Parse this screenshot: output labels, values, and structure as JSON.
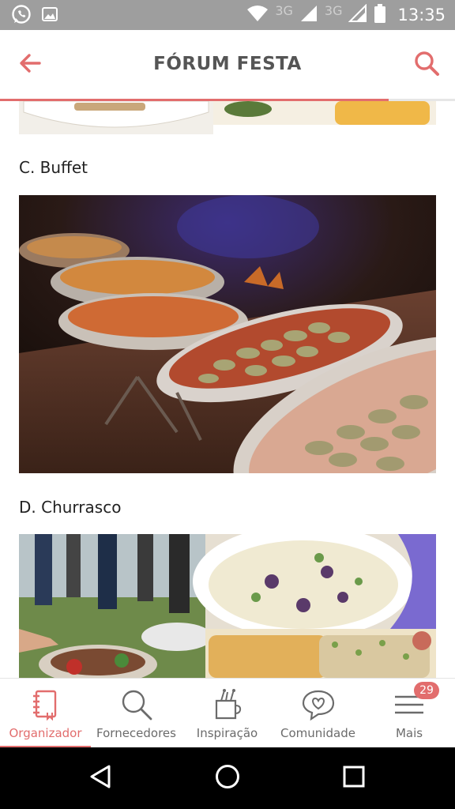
{
  "status_bar": {
    "network_1": "3G",
    "network_2": "3G",
    "time": "13:35",
    "icons": [
      "whatsapp-icon",
      "image-icon",
      "wifi-icon",
      "signal-icon",
      "signal-icon",
      "battery-icon"
    ]
  },
  "header": {
    "title": "FÓRUM FESTA",
    "back_icon": "arrow-left-icon",
    "search_icon": "search-icon",
    "reading_progress": 0.855
  },
  "content": {
    "sections": [
      {
        "label": "C. Buffet",
        "image": "buffet-food-photo"
      },
      {
        "label": "D. Churrasco",
        "image": "churrasco-food-photo"
      }
    ]
  },
  "bottom_nav": {
    "items": [
      {
        "label": "Organizador",
        "icon": "notebook-icon",
        "active": true
      },
      {
        "label": "Fornecedores",
        "icon": "search-icon",
        "active": false
      },
      {
        "label": "Inspiração",
        "icon": "inspiration-cup-icon",
        "active": false
      },
      {
        "label": "Comunidade",
        "icon": "chat-heart-icon",
        "active": false
      },
      {
        "label": "Mais",
        "icon": "menu-icon",
        "active": false,
        "badge": "29"
      }
    ]
  },
  "colors": {
    "accent": "#e26d6d",
    "status_bar": "#9e9e9e",
    "title_text": "#555555",
    "nav_label": "#6b6b6b"
  }
}
